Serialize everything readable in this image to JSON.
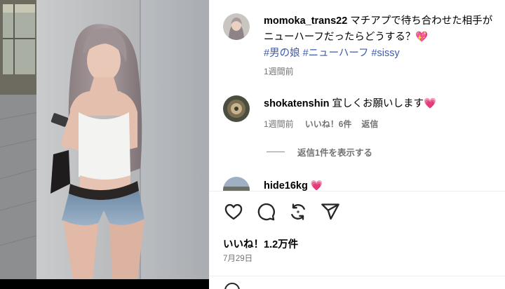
{
  "post": {
    "username": "momoka_trans22",
    "caption_text": "マチアプで待ち合わせた相手がニューハーフだったらどうする？💖",
    "hashtags": [
      "#男の娘",
      "#ニューハーフ",
      "#sissy"
    ],
    "time": "1週間前"
  },
  "comments": [
    {
      "username": "shokatenshin",
      "text": "宜しくお願いします💗",
      "time": "1週間前",
      "likes": "いいね！6件",
      "reply_label": "返信",
      "view_replies": "返信1件を表示する"
    },
    {
      "username": "hide16kg",
      "text": "💗"
    }
  ],
  "footer": {
    "likes": "いいね！1.2万件",
    "date": "7月29日"
  },
  "icons": {
    "like": "heart-icon",
    "comment": "comment-icon",
    "share": "repost-icon",
    "send": "send-icon"
  },
  "colors": {
    "hashtag": "#3f5ba9",
    "meta_text": "#737373",
    "divider": "#efefef"
  }
}
